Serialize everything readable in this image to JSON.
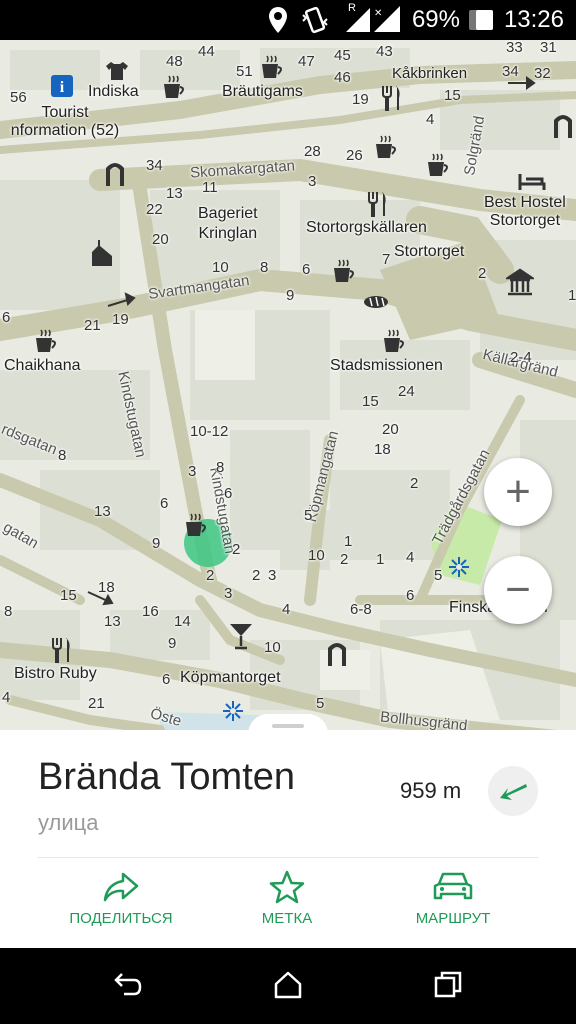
{
  "status_bar": {
    "battery_percent": "69%",
    "time": "13:26",
    "roaming_indicator": "R",
    "icons": [
      "location-icon",
      "vibrate-icon",
      "signal-icon",
      "battery-icon"
    ]
  },
  "map": {
    "pois": [
      {
        "name": "tourist-info",
        "label": "Tourist\nnformation (52)"
      },
      {
        "name": "indiska",
        "label": "Indiska"
      },
      {
        "name": "brautigams",
        "label": "Bräutigams"
      },
      {
        "name": "bageriet-kringlan",
        "label": "Bageriet\nKringlan"
      },
      {
        "name": "stortorgskallaren",
        "label": "Stortorgskällaren"
      },
      {
        "name": "best-hostel",
        "label": "Best Hostel\nStortorget"
      },
      {
        "name": "chaikhana",
        "label": "Chaikhana"
      },
      {
        "name": "stadsmissionen",
        "label": "Stadsmissionen"
      },
      {
        "name": "bistro-ruby",
        "label": "Bistro Ruby"
      },
      {
        "name": "finska-kyrkan",
        "label": "Finska kyrkan"
      }
    ],
    "streets": {
      "kakbrinken": "Kåkbrinken",
      "skomakargatan": "Skomakargatan",
      "stortorget": "Stortorget",
      "svartmangatan": "Svartmangatan",
      "kindstugatan_1": "Kindstugatan",
      "kindstugatan_2": "Kindstugatan",
      "kallargrand": "Källargränd",
      "kopmangatan": "Köpmangatan",
      "tradgardsgatan": "Trädgårdsgatan",
      "tradgardsgatan_left": "rdsgatan",
      "gatan_left": "gatan",
      "solgrand": "Solgränd",
      "kopmantorget": "Köpmantorget",
      "bollhusgrand": "Bollhusgränd",
      "oste": "Öste"
    },
    "numbers": [
      "44",
      "48",
      "47",
      "45",
      "43",
      "33",
      "31",
      "56",
      "51",
      "46",
      "32",
      "34",
      "19",
      "15",
      "4",
      "34",
      "28",
      "26",
      "13",
      "11",
      "3",
      "22",
      "20",
      "10",
      "8",
      "6",
      "7",
      "2",
      "1",
      "9",
      "6",
      "21",
      "19",
      "10-12",
      "15",
      "24",
      "2-4",
      "20",
      "8",
      "3",
      "8",
      "18",
      "2",
      "6",
      "13",
      "6",
      "5",
      "9",
      "2",
      "1",
      "2",
      "10",
      "2",
      "3",
      "1",
      "4",
      "5",
      "2",
      "3",
      "18",
      "15",
      "16",
      "14",
      "4",
      "6-8",
      "6",
      "8",
      "13",
      "9",
      "10",
      "6",
      "21",
      "4",
      "5"
    ],
    "zoom_in": "+",
    "zoom_out": "−"
  },
  "place": {
    "name": "Brända Tomten",
    "type": "улица",
    "distance": "959 m"
  },
  "actions": {
    "share": "ПОДЕЛИТЬСЯ",
    "bookmark": "МЕТКА",
    "route": "МАРШРУТ"
  },
  "colors": {
    "accent": "#1f9b57",
    "map_bg": "#e9ebe3",
    "road": "#c9c9ad",
    "building": "#d9dbd0",
    "park": "#c7eaa8",
    "location_dot": "#3cc782"
  }
}
